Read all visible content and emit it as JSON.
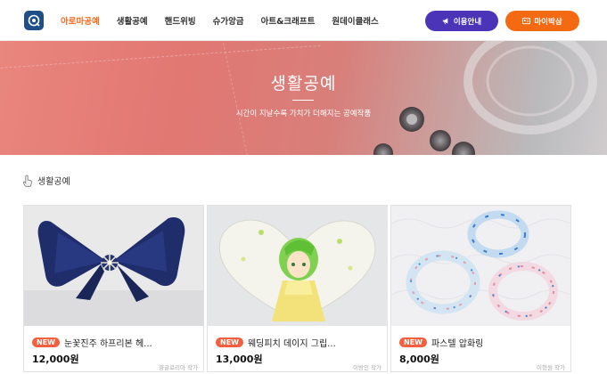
{
  "header": {
    "nav": [
      "아로마공예",
      "생활공예",
      "핸드위빙",
      "슈가앙금",
      "아트&크래프트",
      "원데이클래스"
    ],
    "active_index": 0,
    "guide_button": "이용안내",
    "mypage_button": "마이박삼"
  },
  "banner": {
    "title": "생활공예",
    "subtitle": "시간이 지날수록 가치가 더해지는 공예작품"
  },
  "section": {
    "title": "생활공예"
  },
  "products": [
    {
      "badge": "NEW",
      "title": "눈꽃진주 하프리본 헤...",
      "price": "12,000원",
      "seller": "향글로리아 작가"
    },
    {
      "badge": "NEW",
      "title": "웨딩피치 데이지 그립...",
      "price": "13,000원",
      "seller": "이방인 작가"
    },
    {
      "badge": "NEW",
      "title": "파스텔 압화링",
      "price": "8,000원",
      "seller": "이형원 작가"
    }
  ],
  "colors": {
    "accent_orange": "#f26b1d",
    "guide_purple": "#4b34b8",
    "mypage_orange": "#f46a12",
    "badge_red": "#f4603f"
  }
}
